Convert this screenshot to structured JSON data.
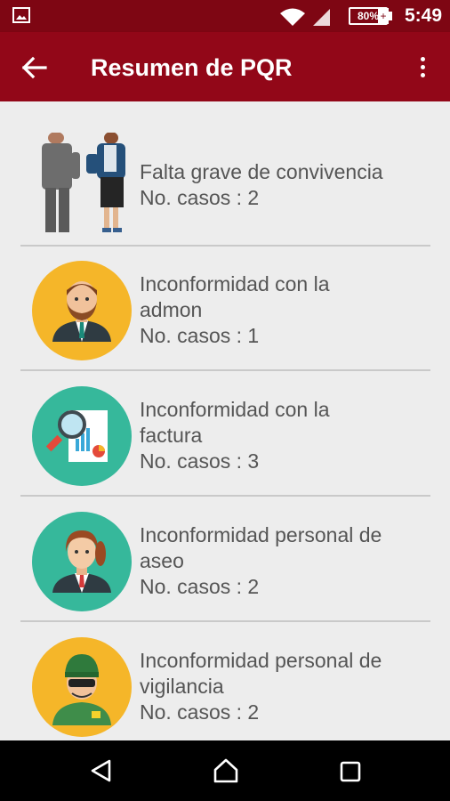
{
  "status_bar": {
    "battery": "80%",
    "time": "5:49",
    "icons": [
      "gallery-icon",
      "wifi-icon",
      "signal-icon",
      "battery-icon",
      "charging-icon"
    ]
  },
  "app_bar": {
    "title": "Resumen de PQR",
    "back_icon": "arrow-left-icon",
    "menu_icon": "more-vertical-icon"
  },
  "items": [
    {
      "title": "Falta grave de convivencia",
      "cases": "No. casos : 2",
      "icon": "people-icon"
    },
    {
      "title_line1": "Inconformidad con la",
      "title_line2": "admon",
      "cases": "No. casos : 1",
      "icon": "administrator-icon",
      "icon_color": "#f5b629"
    },
    {
      "title_line1": "Inconformidad con la",
      "title_line2": "factura",
      "cases": "No. casos : 3",
      "icon": "invoice-magnifier-icon",
      "icon_color": "#36b89b"
    },
    {
      "title_line1": "Inconformidad personal de",
      "title_line2": "aseo",
      "cases": "No. casos : 2",
      "icon": "cleaning-staff-icon",
      "icon_color": "#36b89b"
    },
    {
      "title_line1": "Inconformidad personal de",
      "title_line2": "vigilancia",
      "cases": "No. casos : 2",
      "icon": "security-guard-icon",
      "icon_color": "#f5b629"
    }
  ],
  "navigation_bar": {
    "icons": [
      "back-triangle-icon",
      "home-icon",
      "recent-apps-icon"
    ]
  },
  "colors": {
    "status_bar": "#7e0613",
    "app_bar": "#920718",
    "background": "#ededed",
    "text": "#555555"
  }
}
